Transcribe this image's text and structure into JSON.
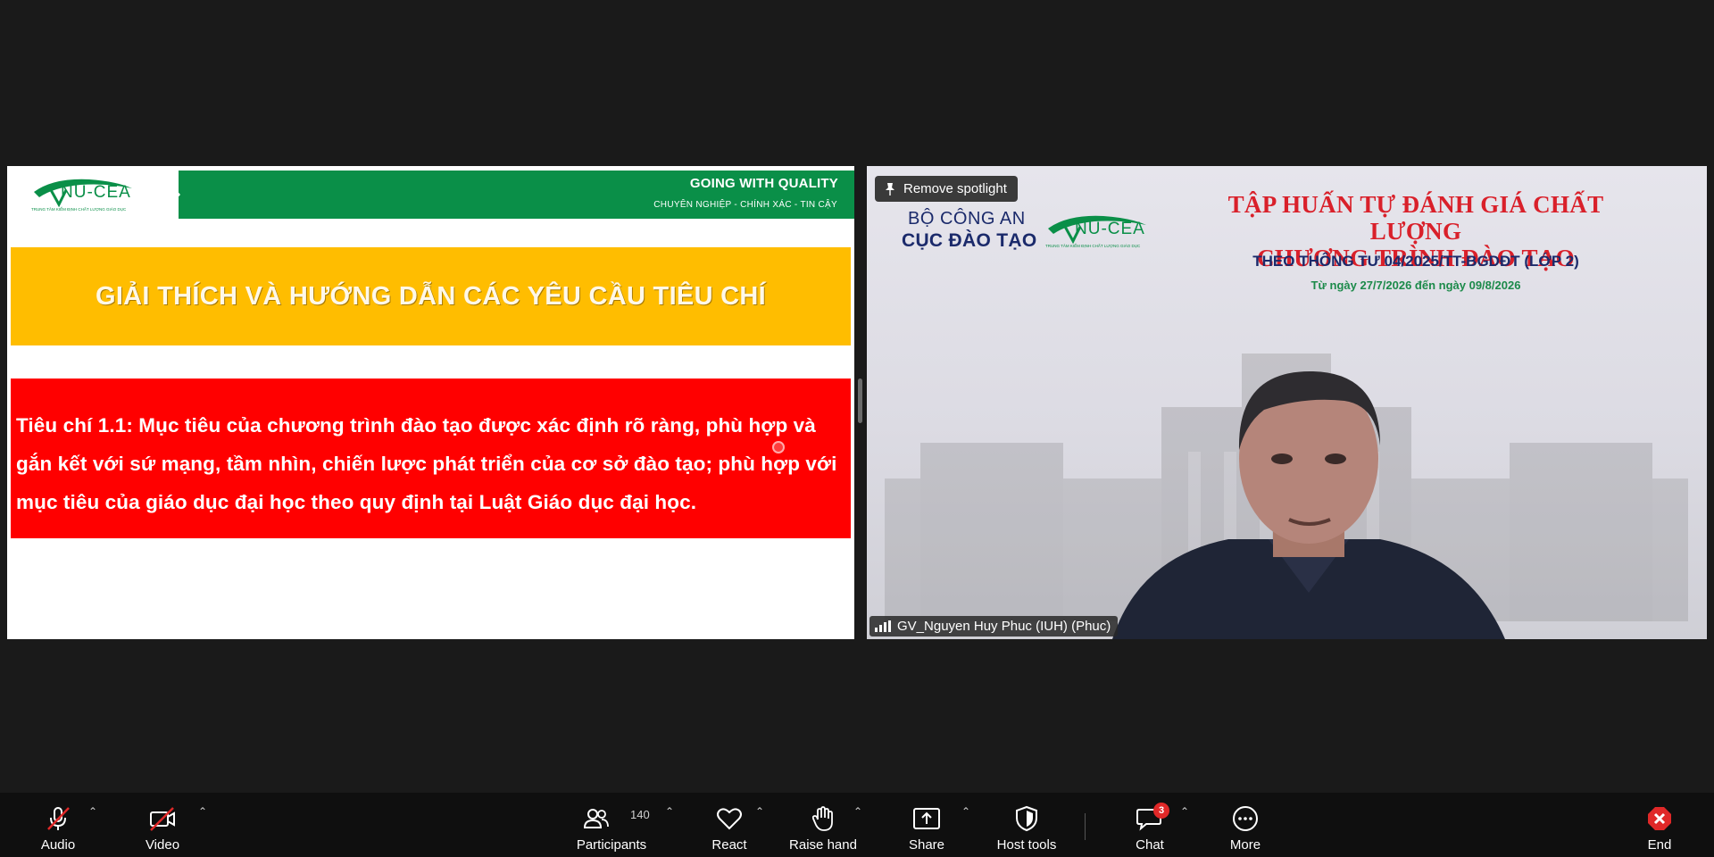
{
  "left_slide": {
    "header_title": "GOING WITH QUALITY",
    "header_subtitle": "CHUYÊN NGHIỆP - CHÍNH XÁC - TIN CẬY",
    "logo_text": "NU-CEA",
    "logo_subtitle": "TRUNG TÂM KIỂM ĐỊNH CHẤT LƯỢNG GIÁO DỤC",
    "heading": "GIẢI THÍCH VÀ HƯỚNG DẪN CÁC YÊU CẦU TIÊU CHÍ",
    "criterion_text": "Tiêu chí 1.1: Mục tiêu của chương trình đào tạo được xác định rõ ràng, phù hợp và gắn kết với sứ mạng, tầm nhìn, chiến lược phát triển của cơ sở đào tạo; phù hợp với mục tiêu của giáo dục đại học theo quy định tại Luật Giáo dục đại học."
  },
  "right_video": {
    "spotlight_button": "Remove spotlight",
    "org_line1": "BỘ CÔNG AN",
    "org_line2": "CỤC ĐÀO TẠO",
    "logo_text": "NU-CEA",
    "logo_subtitle": "TRUNG TÂM KIỂM ĐỊNH CHẤT LƯỢNG GIÁO DỤC",
    "event_title_line1": "TẬP HUẤN TỰ ĐÁNH GIÁ CHẤT LƯỢNG",
    "event_title_line2": "CHƯƠNG TRÌNH ĐÀO TẠO",
    "event_subtitle": "THEO THÔNG TƯ 04/2025/TT-BGDĐT (LỚP 2)",
    "event_dates": "Từ ngày 27/7/2026 đến ngày 09/8/2026",
    "participant_name": "GV_Nguyen Huy Phuc (IUH) (Phuc)"
  },
  "toolbar": {
    "audio": "Audio",
    "video": "Video",
    "participants": "Participants",
    "participants_count": "140",
    "react": "React",
    "raise_hand": "Raise hand",
    "share": "Share",
    "host_tools": "Host tools",
    "chat": "Chat",
    "chat_badge": "3",
    "more": "More",
    "end": "End"
  },
  "colors": {
    "accent_green": "#0a8f48",
    "slide_yellow": "#ffbd00",
    "slide_red": "#ff0000",
    "end_red": "#e02828"
  }
}
